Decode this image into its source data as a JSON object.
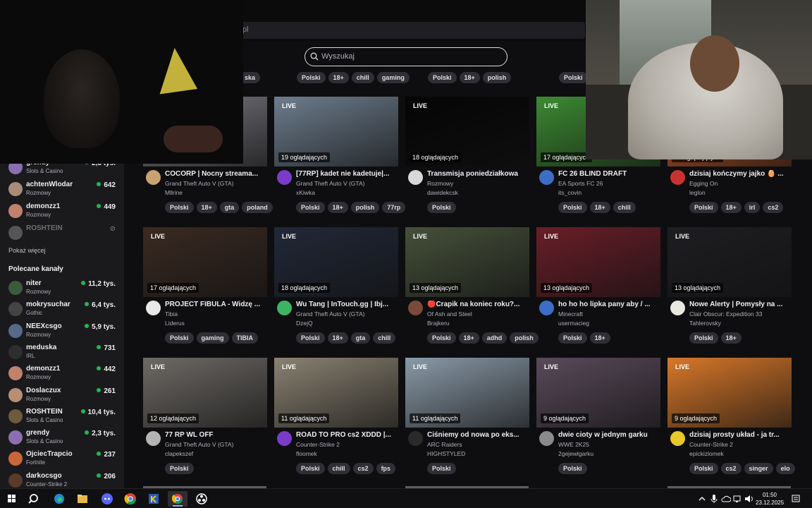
{
  "browser": {
    "url": "pl"
  },
  "search": {
    "placeholder": "Wyszukaj"
  },
  "top_tags": [
    {
      "tags": [
        "ska"
      ]
    },
    {
      "tags": [
        "Polski",
        "18+",
        "chill",
        "gaming"
      ]
    },
    {
      "tags": [
        "Polski",
        "18+",
        "polish"
      ]
    },
    {
      "tags": [
        "Polski"
      ]
    }
  ],
  "sidebar": {
    "followed": [
      {
        "name": "grendy",
        "game": "Slots & Casino",
        "viewers": "2,3 tys.",
        "live": true,
        "color": "#8a6fb0"
      },
      {
        "name": "achtenWlodar",
        "game": "Rozmowy",
        "viewers": "642",
        "live": true,
        "color": "#a88b79"
      },
      {
        "name": "demonzz1",
        "game": "Rozmowy",
        "viewers": "449",
        "live": true,
        "color": "#c0826d"
      },
      {
        "name": "ROSHTEIN",
        "game": "",
        "viewers": "",
        "live": false,
        "color": "#555"
      }
    ],
    "show_more": "Pokaż więcej",
    "recommended_title": "Polecane kanały",
    "recommended": [
      {
        "name": "niter",
        "game": "Rozmowy",
        "viewers": "11,2 tys.",
        "color": "#3c5a3c"
      },
      {
        "name": "mokrysuchar",
        "game": "Gothic",
        "viewers": "6,4 tys.",
        "color": "#444"
      },
      {
        "name": "NEEXcsgo",
        "game": "Rozmowy",
        "viewers": "5,9 tys.",
        "color": "#566a8a"
      },
      {
        "name": "meduska",
        "game": "IRL",
        "viewers": "731",
        "color": "#2e2e2e"
      },
      {
        "name": "demonzz1",
        "game": "Rozmowy",
        "viewers": "442",
        "color": "#c0826d"
      },
      {
        "name": "Doslaczux",
        "game": "Rozmowy",
        "viewers": "261",
        "color": "#b98e72"
      },
      {
        "name": "ROSHTEIN",
        "game": "Slots & Casino",
        "viewers": "10,4 tys.",
        "color": "#6e5a3c"
      },
      {
        "name": "grendy",
        "game": "Slots & Casino",
        "viewers": "2,3 tys.",
        "color": "#8a6fb0"
      },
      {
        "name": "OjciecTrapcio",
        "game": "Fortnite",
        "viewers": "237",
        "color": "#c8663a"
      },
      {
        "name": "darkocsgo",
        "game": "Counter-Strike 2",
        "viewers": "206",
        "color": "#5a3a2a"
      }
    ]
  },
  "streams": [
    {
      "live": "",
      "viewers": "",
      "title": "COCORP | Nocny streama...",
      "game": "Grand Theft Auto V (GTA)",
      "user": "Mllrine",
      "tags": [
        "Polski",
        "18+",
        "gta",
        "poland"
      ],
      "thumb": "#7a7a82",
      "avatar": "#c8a270"
    },
    {
      "live": "LIVE",
      "viewers": "19 oglądających",
      "title": "[77RP] kadet nie kadetuje|...",
      "game": "Grand Theft Auto V (GTA)",
      "user": "xKiwka",
      "tags": [
        "Polski",
        "18+",
        "polish",
        "77rp"
      ],
      "thumb": "#6d7d8d",
      "avatar": "#7a3cc8"
    },
    {
      "live": "LIVE",
      "viewers": "18 oglądających",
      "title": "Transmisja poniedziałkowa",
      "game": "Rozmowy",
      "user": "dawidekcsk",
      "tags": [
        "Polski"
      ],
      "thumb": "#050505",
      "avatar": "#d8d8d8"
    },
    {
      "live": "LIVE",
      "viewers": "17 oglądających",
      "title": "FC 26 BLIND DRAFT",
      "game": "EA Sports FC 26",
      "user": "its_covin",
      "tags": [
        "Polski",
        "18+",
        "chill"
      ],
      "thumb": "#3c8a32",
      "avatar": "#3c6ec8"
    },
    {
      "live": "LIVE",
      "viewers": "17 oglądających",
      "title": "dzisiaj kończymy jajko 🥚 ...",
      "game": "Egging On",
      "user": "leglon",
      "tags": [
        "Polski",
        "18+",
        "irl",
        "cs2"
      ],
      "thumb": "#c85a28",
      "avatar": "#c83232"
    },
    {
      "live": "LIVE",
      "viewers": "17 oglądających",
      "title": "PROJECT FIBULA - Widzę ...",
      "game": "Tibia",
      "user": "Liderus",
      "tags": [
        "Polski",
        "gaming",
        "TIBIA"
      ],
      "thumb": "#3a2a22",
      "avatar": "#e8e8e8"
    },
    {
      "live": "LIVE",
      "viewers": "18 oglądających",
      "title": "Wu Tang | InTouch.gg | Ibj...",
      "game": "Grand Theft Auto V (GTA)",
      "user": "DzejQ",
      "tags": [
        "Polski",
        "18+",
        "gta",
        "chill"
      ],
      "thumb": "#222838",
      "avatar": "#3cb464"
    },
    {
      "live": "LIVE",
      "viewers": "13 oglądających",
      "title": "🔴Crapik na koniec roku?...",
      "game": "Of Ash and Steel",
      "user": "Brajkeru",
      "tags": [
        "Polski",
        "18+",
        "adhd",
        "polish"
      ],
      "thumb": "#46503a",
      "avatar": "#7a4a3a"
    },
    {
      "live": "LIVE",
      "viewers": "13 oglądających",
      "title": "ho ho ho lipka pany aby / ...",
      "game": "Minecraft",
      "user": "usermacieg",
      "tags": [
        "Polski",
        "18+"
      ],
      "thumb": "#6a1e28",
      "avatar": "#3c6ec8"
    },
    {
      "live": "LIVE",
      "viewers": "13 oglądających",
      "title": "Nowe Alerty | Pomysły na ...",
      "game": "Clair Obscur: Expedition 33",
      "user": "Tahlerovsky",
      "tags": [
        "Polski",
        "18+"
      ],
      "thumb": "#1e1e22",
      "avatar": "#e8e8e0"
    },
    {
      "live": "LIVE",
      "viewers": "12 oglądających",
      "title": "77 RP WL OFF",
      "game": "Grand Theft Auto V (GTA)",
      "user": "clapekszef",
      "tags": [
        "Polski"
      ],
      "thumb": "#6e6a66",
      "avatar": "#b4b4b4"
    },
    {
      "live": "LIVE",
      "viewers": "11 oglądających",
      "title": "ROAD TO PRO cs2 XDDD |...",
      "game": "Counter-Strike 2",
      "user": "floomek",
      "tags": [
        "Polski",
        "chill",
        "cs2",
        "fps"
      ],
      "thumb": "#8a8272",
      "avatar": "#7a3cc8"
    },
    {
      "live": "LIVE",
      "viewers": "11 oglądających",
      "title": "Ciśniemy od nowa po eks...",
      "game": "ARC Raiders",
      "user": "HIGHSTYLED",
      "tags": [
        "Polski"
      ],
      "thumb": "#8a9aa8",
      "avatar": "#2a2a2a"
    },
    {
      "live": "LIVE",
      "viewers": "9 oglądających",
      "title": "dwie cioty w jednym garku",
      "game": "WWE 2K25",
      "user": "2gejewlgarku",
      "tags": [
        "Polski"
      ],
      "thumb": "#5a4a5a",
      "avatar": "#8a8a8a"
    },
    {
      "live": "LIVE",
      "viewers": "9 oglądających",
      "title": "dzisiaj prosty układ - ja tr...",
      "game": "Counter-Strike 2",
      "user": "epickizlomek",
      "tags": [
        "Polski",
        "cs2",
        "singer",
        "elo"
      ],
      "thumb": "#d8782a",
      "avatar": "#e8c82a"
    }
  ],
  "clock": {
    "time": "01:50",
    "date": "23.12.2025"
  }
}
